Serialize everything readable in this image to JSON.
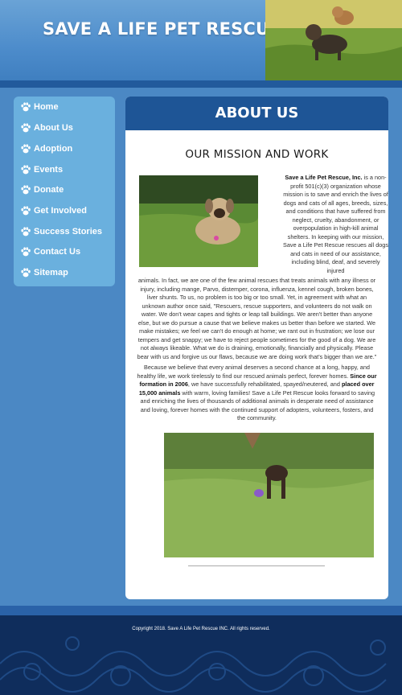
{
  "header": {
    "title": "SAVE A LIFE PET RESCUE"
  },
  "nav": {
    "items": [
      {
        "label": "Home"
      },
      {
        "label": "About Us"
      },
      {
        "label": "Adoption"
      },
      {
        "label": "Events"
      },
      {
        "label": "Donate"
      },
      {
        "label": "Get Involved"
      },
      {
        "label": "Success Stories"
      },
      {
        "label": "Contact Us"
      },
      {
        "label": "Sitemap"
      }
    ],
    "icon": "paw-icon"
  },
  "main": {
    "heading": "ABOUT US",
    "subheading": "OUR MISSION AND WORK",
    "intro_bold": "Save a Life Pet Rescue, Inc.",
    "intro_text": " is a non-profit 501(c)(3) organization whose mission is to save and enrich the lives of dogs and cats of all ages, breeds, sizes, and conditions that have suffered from neglect, cruelty, abandonment, or overpopulation in high-kill animal shelters.  In keeping with our mission, Save a Life Pet Rescue rescues all dogs and cats in need of our assistance, including blind, deaf, and severely injured",
    "para1": "animals. In fact, we are one of the few animal rescues that treats animals with any illness or injury, including mange, Parvo, distemper, corona, influenza, kennel cough, broken bones, liver shunts. To us, no problem is too big or too small. Yet, in agreement with what an unknown author once said, \"Rescuers, rescue supporters, and volunteers do not walk on water. We don't wear capes and tights or leap tall buildings. We aren't better than anyone else, but we do pursue a cause that we believe makes us better than before we started. We make mistakes; we feel we can't do enough at home; we rant out in frustration; we lose our tempers and get snappy; we have to reject people sometimes for the good of a dog. We are not always likeable. What we do is draining, emotionally, financially and physically. Please bear with us and forgive us our flaws, because we are doing work that's bigger than we are.\"",
    "para2_a": "Because we believe that every animal deserves a second chance at a long, happy, and healthy life, we work tirelessly to find our rescued animals perfect, forever homes. ",
    "para2_b": "Since our formation in 2006",
    "para2_c": ", we have successfully rehabilitated, spayed/neutered, and ",
    "para2_d": "placed over 15,000 animals",
    "para2_e": " with warm, loving families! Save a Life Pet Rescue looks forward to saving and enriching the lives of thousands of additional animals in desperate need of assistance and loving, forever homes with the continued support of adopters, volunteers, fosters, and the community."
  },
  "footer": {
    "copyright": "Copyright 2018. Save A Life Pet Rescue INC. All rights reserved."
  }
}
